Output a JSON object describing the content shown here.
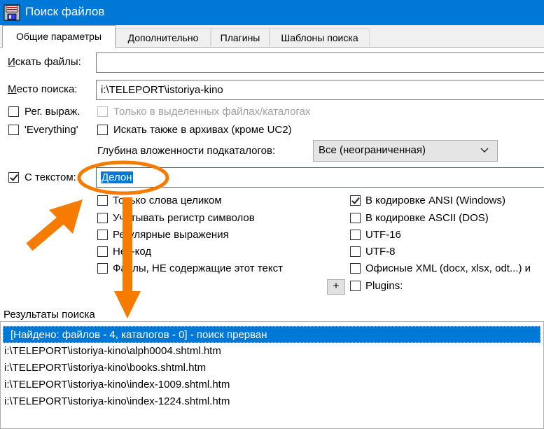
{
  "window": {
    "title": "Поиск файлов"
  },
  "tabs": [
    "Общие параметры",
    "Дополнительно",
    "Плагины",
    "Шаблоны поиска"
  ],
  "search_files": {
    "label": "Искать файлы:",
    "value": ""
  },
  "search_location": {
    "label": "Место поиска:",
    "value": "i:\\TELEPORT\\istoriya-kino"
  },
  "options_left": [
    {
      "label": "Рег. выраж.",
      "checked": false
    },
    {
      "label": "'Everything'",
      "checked": false
    }
  ],
  "options_right": [
    {
      "label": "Только в выделенных файлах/каталогах",
      "checked": false,
      "disabled": true
    },
    {
      "label": "Искать также в архивах (кроме UC2)",
      "checked": false
    }
  ],
  "depth": {
    "label": "Глубина вложенности подкаталогов:",
    "value": "Все (неограниченная)"
  },
  "with_text": {
    "label": "С текстом:",
    "checked": true,
    "value": "Делон"
  },
  "text_options_left": [
    {
      "label": "Только слова целиком",
      "checked": false
    },
    {
      "label": "Учитывать регистр символов",
      "checked": false
    },
    {
      "label": "Регулярные выражения",
      "checked": false
    },
    {
      "label": "Hex-код",
      "checked": false
    },
    {
      "label": "Файлы, НЕ содержащие этот текст",
      "checked": false
    }
  ],
  "text_options_right": [
    {
      "label": "В кодировке ANSI (Windows)",
      "checked": true
    },
    {
      "label": "В кодировке ASCII (DOS)",
      "checked": false
    },
    {
      "label": "UTF-16",
      "checked": false
    },
    {
      "label": "UTF-8",
      "checked": false
    },
    {
      "label": "Офисные XML (docx, xlsx, odt...) и",
      "checked": false
    },
    {
      "label": "Plugins:",
      "checked": false
    }
  ],
  "plus_button": "+",
  "results": {
    "header": "Результаты поиска",
    "rows": [
      "[Найдено: файлов - 4, каталогов - 0] - поиск прерван",
      "i:\\TELEPORT\\istoriya-kino\\alph0004.shtml.htm",
      "i:\\TELEPORT\\istoriya-kino\\books.shtml.htm",
      "i:\\TELEPORT\\istoriya-kino\\index-1009.shtml.htm",
      "i:\\TELEPORT\\istoriya-kino\\index-1224.shtml.htm"
    ]
  },
  "colors": {
    "accent": "#0078d7",
    "annotation": "#f57c00"
  }
}
